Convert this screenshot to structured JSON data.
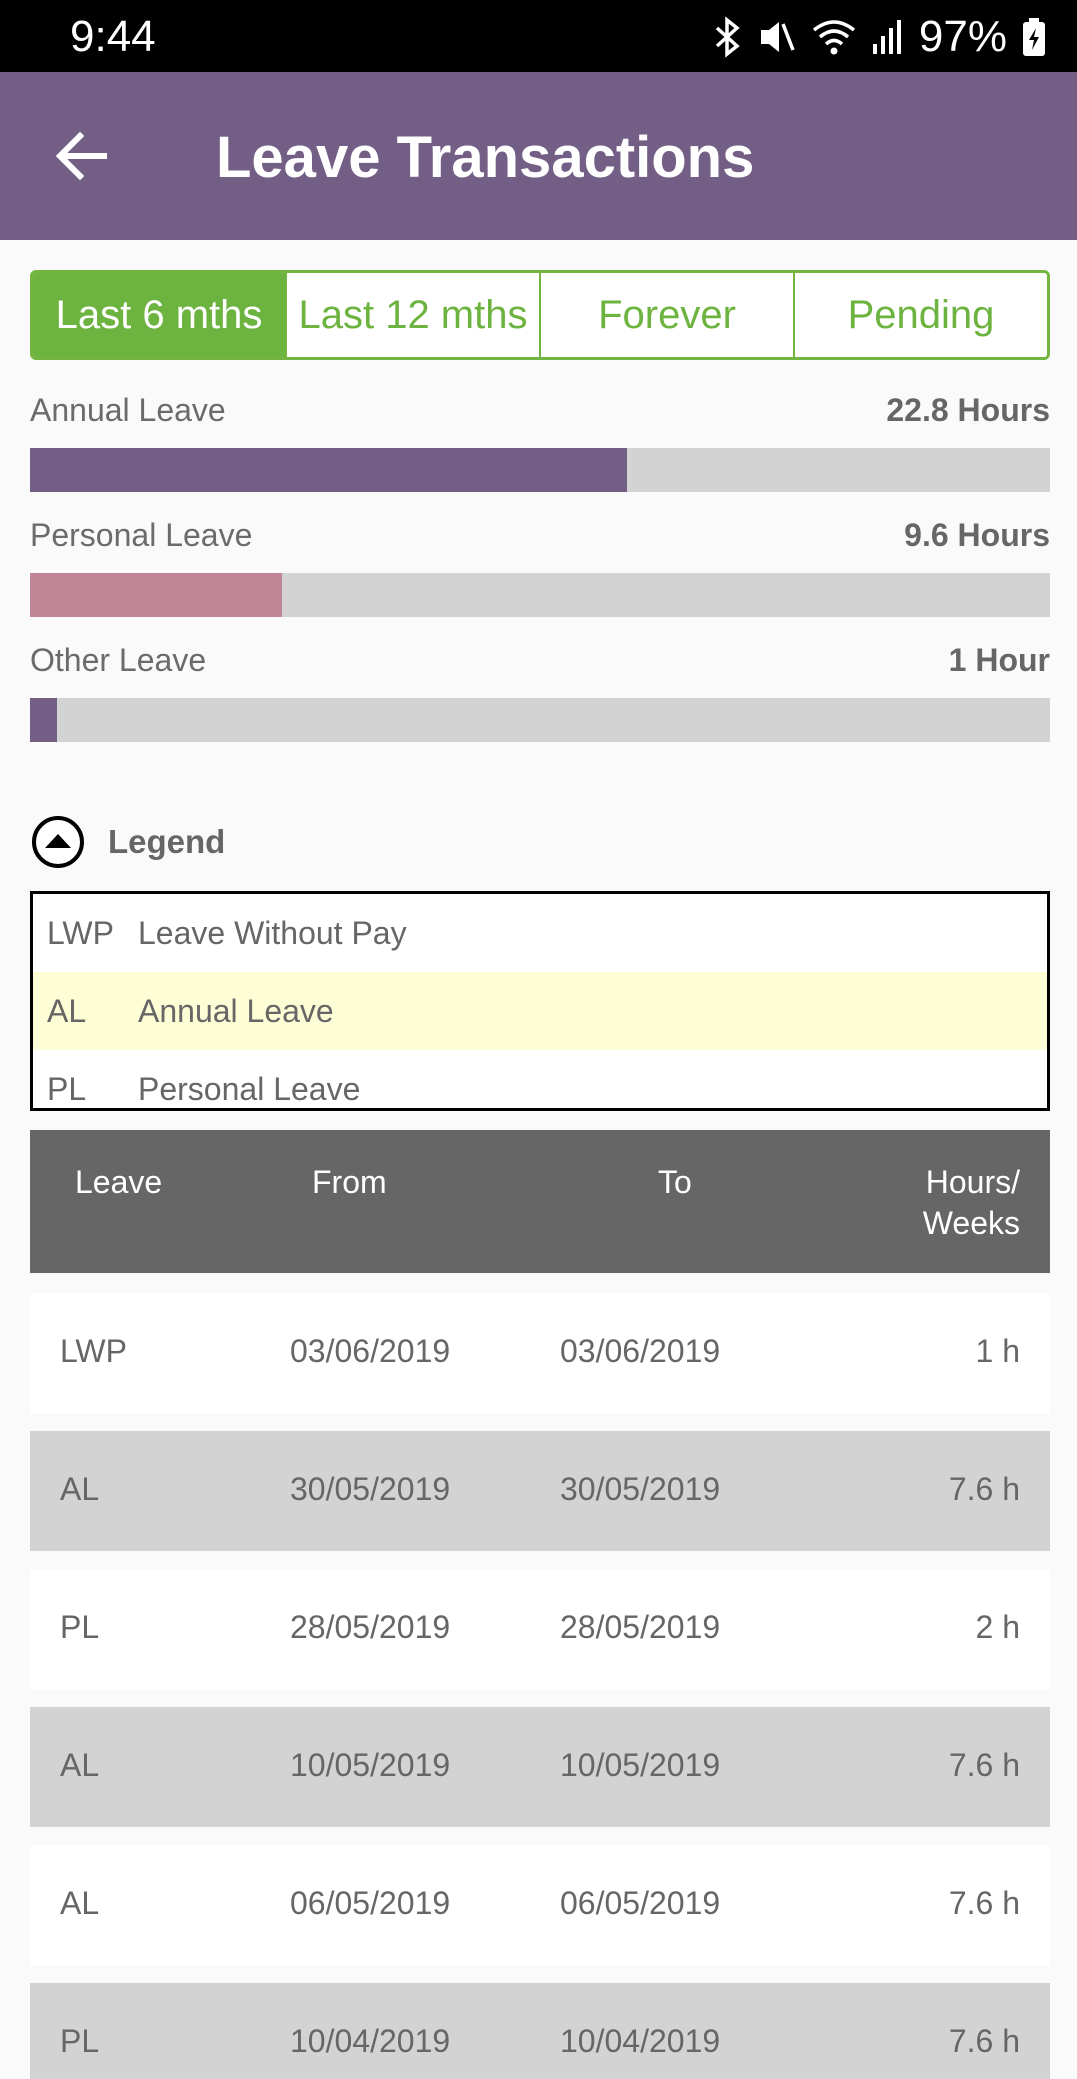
{
  "status_bar": {
    "time": "9:44",
    "battery": "97%",
    "icons": [
      "bluetooth-icon",
      "mute-icon",
      "wifi-icon",
      "signal-icon",
      "battery-charging-icon"
    ]
  },
  "app_bar": {
    "title": "Leave Transactions",
    "back_icon": "arrow-left-icon",
    "color": "#735f86"
  },
  "tabs": [
    {
      "label": "Last 6 mths",
      "active": true
    },
    {
      "label": "Last 12 mths",
      "active": false
    },
    {
      "label": "Forever",
      "active": false
    },
    {
      "label": "Pending",
      "active": false
    }
  ],
  "balances": [
    {
      "label": "Annual Leave",
      "value": "22.8 Hours",
      "fill_percent": 58.5,
      "color": "#735f86"
    },
    {
      "label": "Personal Leave",
      "value": "9.6 Hours",
      "fill_percent": 24.7,
      "color": "#c08596"
    },
    {
      "label": "Other Leave",
      "value": "1 Hour",
      "fill_percent": 2.6,
      "color": "#735f86"
    }
  ],
  "legend": {
    "title": "Legend",
    "items": [
      {
        "code": "LWP",
        "name": "Leave Without Pay"
      },
      {
        "code": "AL",
        "name": "Annual Leave"
      },
      {
        "code": "PL",
        "name": "Personal Leave"
      }
    ]
  },
  "table": {
    "headers": {
      "leave": "Leave",
      "from": "From",
      "to": "To",
      "hours_line1": "Hours/",
      "hours_line2": "Weeks"
    },
    "rows": [
      {
        "leave": "LWP",
        "from": "03/06/2019",
        "to": "03/06/2019",
        "hours": "1 h"
      },
      {
        "leave": "AL",
        "from": "30/05/2019",
        "to": "30/05/2019",
        "hours": "7.6 h"
      },
      {
        "leave": "PL",
        "from": "28/05/2019",
        "to": "28/05/2019",
        "hours": "2 h"
      },
      {
        "leave": "AL",
        "from": "10/05/2019",
        "to": "10/05/2019",
        "hours": "7.6 h"
      },
      {
        "leave": "AL",
        "from": "06/05/2019",
        "to": "06/05/2019",
        "hours": "7.6 h"
      },
      {
        "leave": "PL",
        "from": "10/04/2019",
        "to": "10/04/2019",
        "hours": "7.6 h"
      }
    ]
  },
  "colors": {
    "accent_green": "#6db33f",
    "bar_track": "#d3d3d3",
    "header_grey": "#666666",
    "row_grey": "#d3d3d3",
    "legend_highlight": "#fefed6"
  }
}
